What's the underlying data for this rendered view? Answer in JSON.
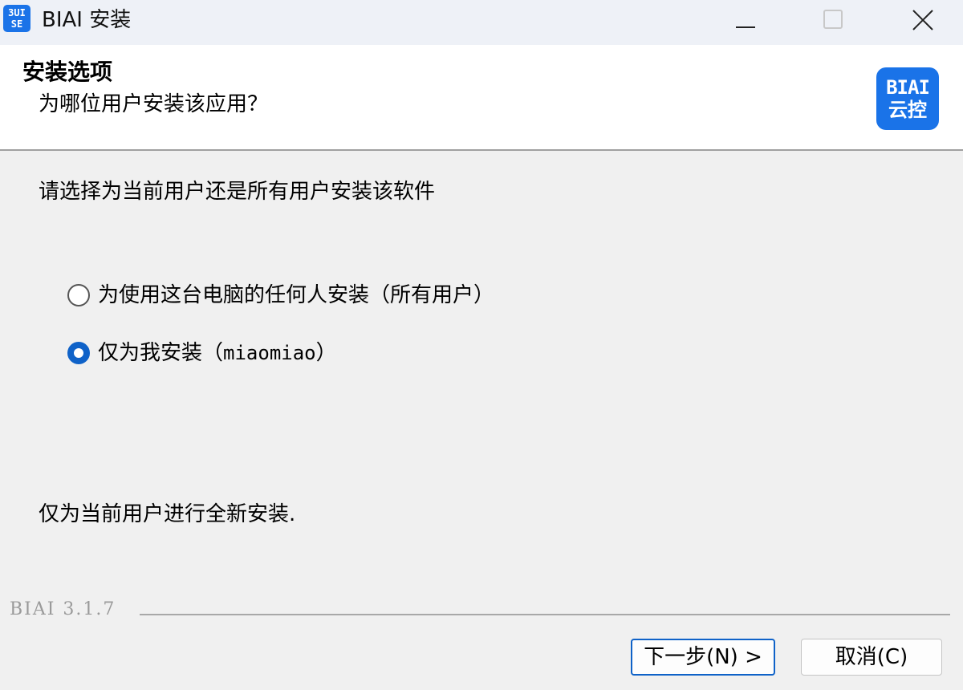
{
  "window": {
    "app_icon_text": "3UI\nSE",
    "title": "BIAI 安装"
  },
  "header": {
    "title": "安装选项",
    "subtitle": "为哪位用户安装该应用？",
    "logo_top": "BIAI",
    "logo_bottom": "云控"
  },
  "main": {
    "prompt": "请选择为当前用户还是所有用户安装该软件",
    "options": [
      {
        "label": "为使用这台电脑的任何人安装（所有用户）",
        "selected": false
      },
      {
        "label_cn": "仅为我安装（",
        "label_user": "miaomiao",
        "label_end": "）",
        "selected": true
      }
    ],
    "description": "仅为当前用户进行全新安装."
  },
  "footer": {
    "version": "BIAI 3.1.7",
    "next_label": "下一步(N) >",
    "cancel_label": "取消(C)"
  },
  "colors": {
    "accent": "#0f62c8",
    "brand": "#1a73e8",
    "dialog_bg": "#f0f0f0",
    "titlebar_bg": "#eef1f7"
  }
}
